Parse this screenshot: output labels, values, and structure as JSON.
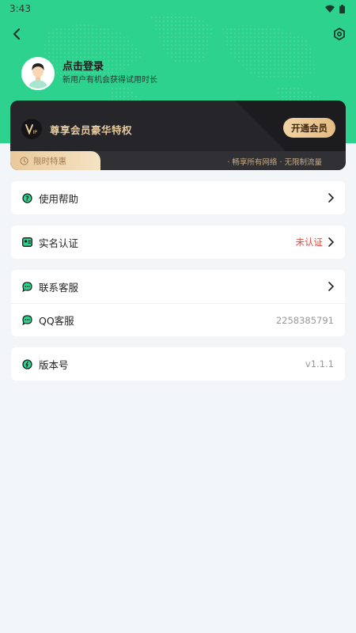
{
  "status_bar": {
    "time": "3:43"
  },
  "profile": {
    "title": "点击登录",
    "subtitle": "新用户有机会获得试用时长"
  },
  "vip": {
    "title": "尊享会员豪华特权",
    "button": "开通会员",
    "limited_label": "限时特惠",
    "benefits": "· 畅享所有网络 · 无限制流量"
  },
  "menu": {
    "help": {
      "label": "使用帮助"
    },
    "realname": {
      "label": "实名认证",
      "value": "未认证"
    },
    "contact": {
      "label": "联系客服"
    },
    "qq": {
      "label": "QQ客服",
      "value": "2258385791"
    },
    "version": {
      "label": "版本号",
      "value": "v1.1.1"
    }
  },
  "colors": {
    "brand_green": "#2ed28f",
    "vip_gold": "#e8c99a",
    "alert_red": "#e8453c"
  },
  "icons": [
    "back-icon",
    "settings-icon",
    "wifi-icon",
    "battery-icon",
    "vip-icon",
    "clock-icon",
    "help-icon",
    "id-card-icon",
    "chat-icon",
    "info-icon",
    "chevron-right-icon"
  ]
}
